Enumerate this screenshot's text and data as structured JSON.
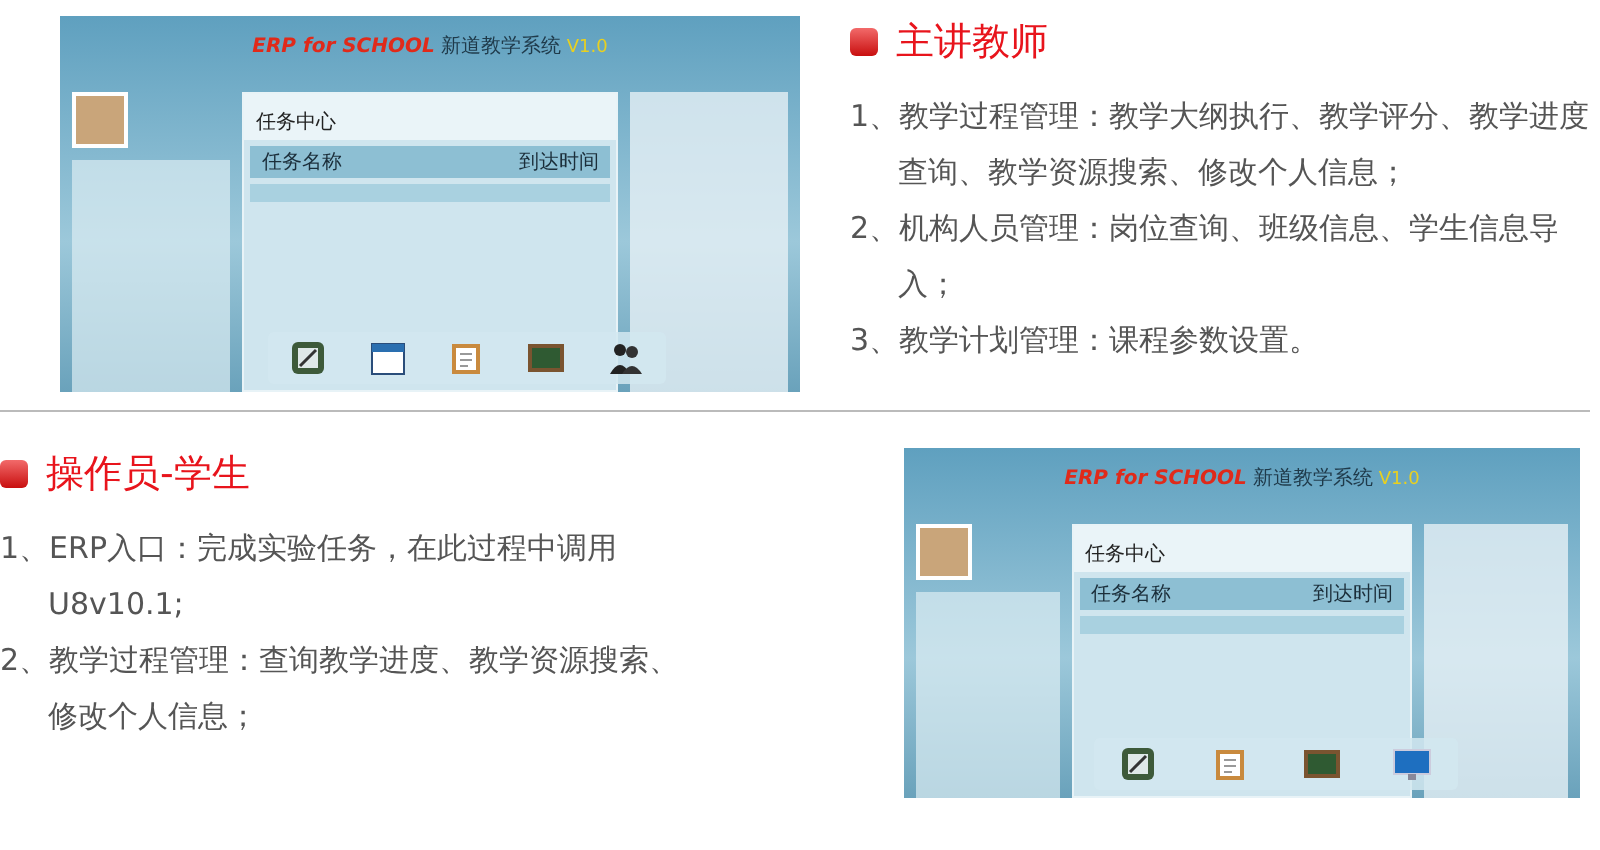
{
  "teacher_section": {
    "screenshot": {
      "title_en": "ERP for SCHOOL",
      "title_cn": "新道教学系统",
      "version": "V1.0",
      "panel_title": "任务中心",
      "columns": [
        "任务名称",
        "到达时间"
      ],
      "dock_icons": [
        {
          "kind": "notepad"
        },
        {
          "kind": "calendar"
        },
        {
          "kind": "clipboard"
        },
        {
          "kind": "chalkboard"
        },
        {
          "kind": "people"
        }
      ]
    },
    "heading": "主讲教师",
    "items": [
      "1、教学过程管理：教学大纲执行、教学评分、教学进度查询、教学资源搜索、修改个人信息；",
      "2、机构人员管理：岗位查询、班级信息、学生信息导入；",
      "3、教学计划管理：课程参数设置。"
    ]
  },
  "student_section": {
    "heading": "操作员-学生",
    "items": [
      "1、ERP入口：完成实验任务，在此过程中调用U8v10.1;",
      "2、教学过程管理：查询教学进度、教学资源搜索、修改个人信息；"
    ],
    "screenshot": {
      "title_en": "ERP for SCHOOL",
      "title_cn": "新道教学系统",
      "version": "V1.0",
      "panel_title": "任务中心",
      "columns": [
        "任务名称",
        "到达时间"
      ],
      "dock_icons": [
        {
          "kind": "notepad"
        },
        {
          "kind": "clipboard"
        },
        {
          "kind": "chalkboard"
        },
        {
          "kind": "monitor"
        }
      ]
    }
  }
}
